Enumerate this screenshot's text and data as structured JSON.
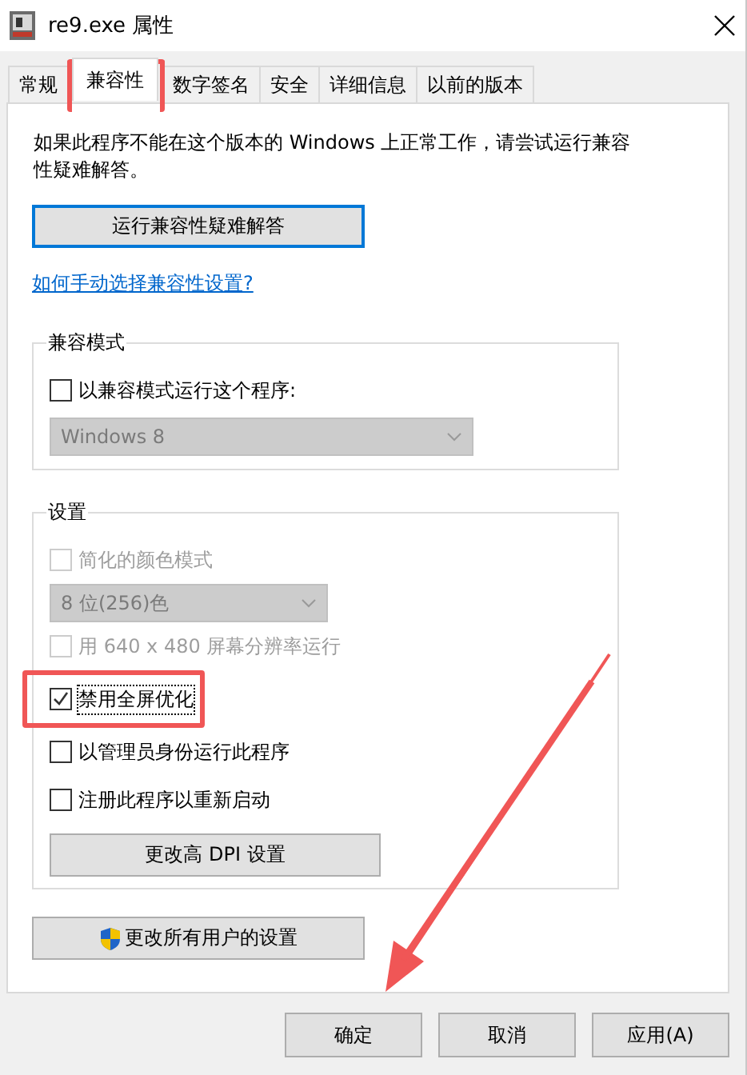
{
  "window": {
    "title": "re9.exe 属性"
  },
  "tabs": [
    {
      "label": "常规",
      "selected": false,
      "highlighted": false
    },
    {
      "label": "兼容性",
      "selected": true,
      "highlighted": true
    },
    {
      "label": "数字签名",
      "selected": false,
      "highlighted": false
    },
    {
      "label": "安全",
      "selected": false,
      "highlighted": false
    },
    {
      "label": "详细信息",
      "selected": false,
      "highlighted": false
    },
    {
      "label": "以前的版本",
      "selected": false,
      "highlighted": false
    }
  ],
  "intro": "如果此程序不能在这个版本的 Windows 上正常工作，请尝试运行兼容性疑难解答。",
  "troubleshoot_button": "运行兼容性疑难解答",
  "help_link": "如何手动选择兼容性设置?",
  "compat_group": {
    "title": "兼容模式",
    "items": [
      {
        "kind": "checkbox",
        "label": "以兼容模式运行这个程序:",
        "checked": false,
        "disabled": false,
        "highlighted": false
      },
      {
        "kind": "select",
        "value": "Windows 8",
        "disabled": true
      }
    ]
  },
  "settings_group": {
    "title": "设置",
    "items": [
      {
        "kind": "checkbox",
        "label": "简化的颜色模式",
        "checked": false,
        "disabled": true,
        "highlighted": false
      },
      {
        "kind": "select",
        "value": "8 位(256)色",
        "disabled": true
      },
      {
        "kind": "checkbox",
        "label": "用 640 x 480 屏幕分辨率运行",
        "checked": false,
        "disabled": true,
        "highlighted": false
      },
      {
        "kind": "checkbox",
        "label": "禁用全屏优化",
        "checked": true,
        "disabled": false,
        "highlighted": true
      },
      {
        "kind": "checkbox",
        "label": "以管理员身份运行此程序",
        "checked": false,
        "disabled": false,
        "highlighted": false
      },
      {
        "kind": "checkbox",
        "label": "注册此程序以重新启动",
        "checked": false,
        "disabled": false,
        "highlighted": false
      },
      {
        "kind": "button",
        "label": "更改高 DPI 设置"
      }
    ]
  },
  "all_users_button": "更改所有用户的设置",
  "buttons": [
    "确定",
    "取消",
    "应用(A)"
  ]
}
